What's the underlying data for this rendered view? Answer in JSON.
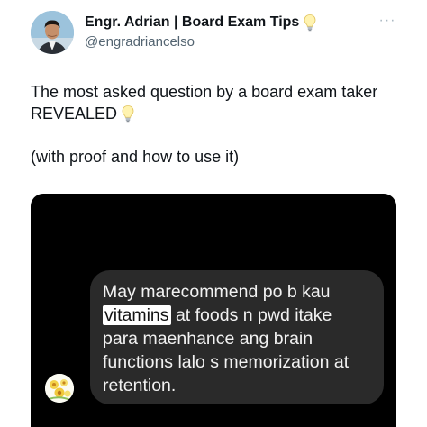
{
  "post": {
    "author_name": "Engr. Adrian | Board Exam Tips",
    "author_handle": "@engradriancelso",
    "author_icon": "lightbulb-icon",
    "more_icon": "more-icon",
    "more_glyph": "···",
    "text_line1": "The most asked question by a board exam taker",
    "text_line2": "REVEALED",
    "text_line2_icon": "lightbulb-icon",
    "text_line3": "(with proof and how to use it)"
  },
  "media": {
    "message": {
      "line1": "May marecommend po b kau",
      "highlight_word": "vitamins",
      "line2_rest": " at foods n pwd itake",
      "line3": "para maenhance ang brain",
      "line4": "functions lalo s memorization at",
      "line5": "retention."
    },
    "sender_avatar_icon": "flower-avatar-icon"
  },
  "colors": {
    "media_background": "#000000",
    "bubble_background": "#2a2a2a",
    "highlight": "#ffffff",
    "handle_text": "#536471"
  }
}
